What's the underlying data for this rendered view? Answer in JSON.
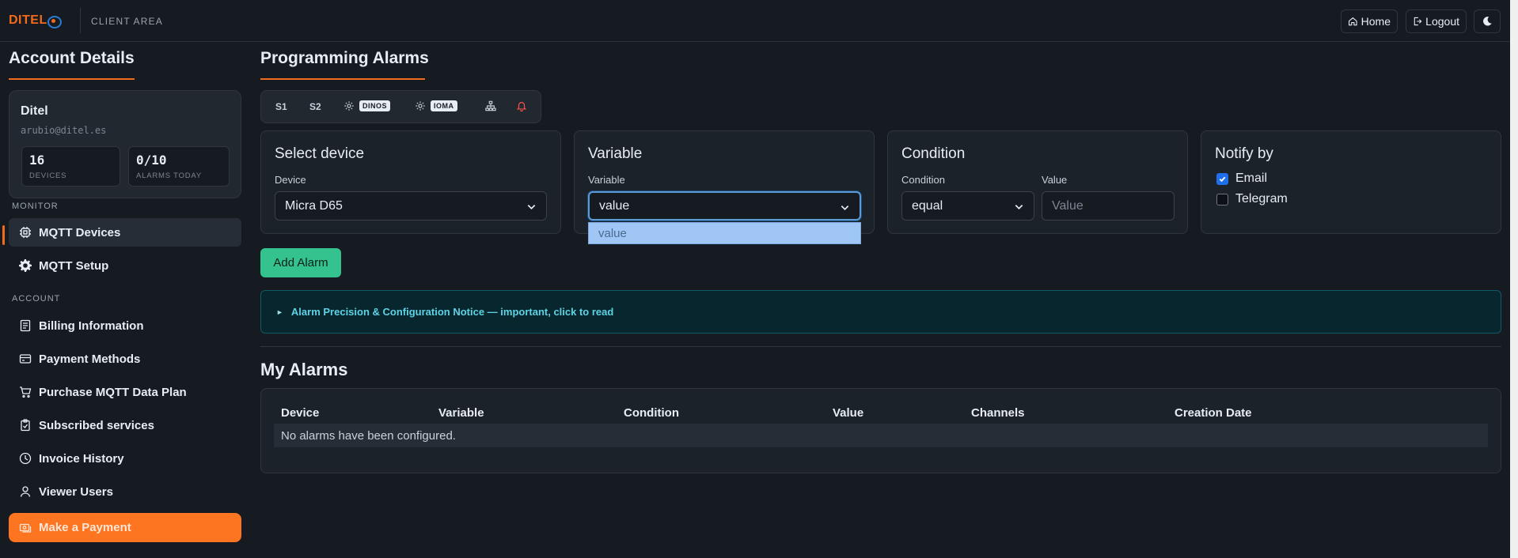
{
  "header": {
    "logo_text": "DITEL",
    "client_area": "CLIENT AREA",
    "home_label": "Home",
    "logout_label": "Logout"
  },
  "sidebar": {
    "title": "Account Details",
    "account": {
      "name": "Ditel",
      "email": "arubio@ditel.es",
      "devices_count": "16",
      "devices_label": "DEVICES",
      "alarms_count": "0/10",
      "alarms_label": "ALARMS TODAY"
    },
    "monitor_label": "MONITOR",
    "monitor_items": [
      {
        "label": "MQTT Devices",
        "icon": "chip-icon",
        "active": true
      },
      {
        "label": "MQTT Setup",
        "icon": "gear-icon",
        "active": false
      }
    ],
    "account_label": "ACCOUNT",
    "account_items": [
      {
        "label": "Billing Information",
        "icon": "document-icon"
      },
      {
        "label": "Payment Methods",
        "icon": "credit-card-icon"
      },
      {
        "label": "Purchase MQTT Data Plan",
        "icon": "cart-icon"
      },
      {
        "label": "Subscribed services",
        "icon": "clipboard-check-icon"
      },
      {
        "label": "Invoice History",
        "icon": "clock-icon"
      },
      {
        "label": "Viewer Users",
        "icon": "user-icon"
      }
    ],
    "payment_button": "Make a Payment"
  },
  "main": {
    "title": "Programming Alarms",
    "toolbar": {
      "s1": "S1",
      "s2": "S2",
      "badge1": "DINOS",
      "badge2": "IOMA"
    },
    "select_device": {
      "title": "Select device",
      "label": "Device",
      "value": "Micra D65"
    },
    "variable": {
      "title": "Variable",
      "label": "Variable",
      "value": "value",
      "options": [
        "value"
      ]
    },
    "condition": {
      "title": "Condition",
      "condition_label": "Condition",
      "condition_value": "equal",
      "value_label": "Value",
      "value_placeholder": "Value"
    },
    "notify": {
      "title": "Notify by",
      "email_label": "Email",
      "email_checked": true,
      "telegram_label": "Telegram",
      "telegram_checked": false
    },
    "add_button": "Add Alarm",
    "notice": "Alarm Precision & Configuration Notice — important, click to read",
    "alarms_title": "My Alarms",
    "table": {
      "columns": [
        "Device",
        "Variable",
        "Condition",
        "Value",
        "Channels",
        "Creation Date"
      ],
      "empty_message": "No alarms have been configured."
    }
  },
  "colors": {
    "accent": "#f26a1b",
    "background": "#161b22",
    "success": "#34c38f",
    "info": "#5dd3e6"
  }
}
